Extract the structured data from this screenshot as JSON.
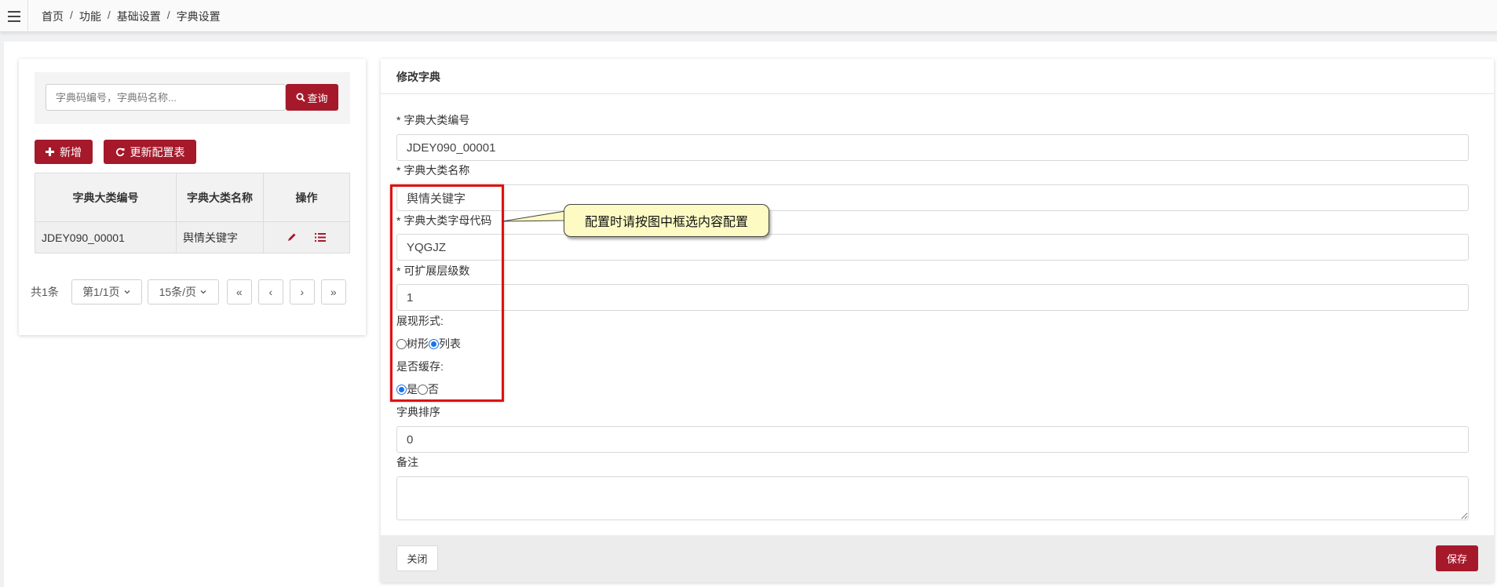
{
  "breadcrumb": {
    "items": [
      "首页",
      "功能",
      "基础设置",
      "字典设置"
    ],
    "separator": "/"
  },
  "search": {
    "placeholder": "字典码编号，字典码名称...",
    "button_label": "查询"
  },
  "toolbar": {
    "add_label": "新增",
    "refresh_label": "更新配置表"
  },
  "table": {
    "columns": [
      "字典大类编号",
      "字典大类名称",
      "操作"
    ],
    "rows": [
      {
        "code": "JDEY090_00001",
        "name": "舆情关键字"
      }
    ]
  },
  "pager": {
    "total": "共1条",
    "page": "第1/1页",
    "page_size": "15条/页",
    "first": "«",
    "prev": "‹",
    "next": "›",
    "last": "»"
  },
  "form": {
    "title": "修改字典",
    "fields": {
      "code_label": "* 字典大类编号",
      "code_value": "JDEY090_00001",
      "name_label": "* 字典大类名称",
      "name_value": "舆情关键字",
      "letter_label": "* 字典大类字母代码",
      "letter_value": "YQGJZ",
      "levels_label": "* 可扩展层级数",
      "levels_value": "1",
      "display_label": "展现形式:",
      "display_opt_tree": "树形",
      "display_opt_list": "列表",
      "display_selected": "列表",
      "cache_label": "是否缓存:",
      "cache_opt_yes": "是",
      "cache_opt_no": "否",
      "cache_selected": "是",
      "order_label": "字典排序",
      "order_value": "0",
      "remark_label": "备注",
      "remark_value": ""
    },
    "close_label": "关闭",
    "save_label": "保存"
  },
  "annotation": {
    "callout_text": "配置时请按图中框选内容配置"
  },
  "colors": {
    "accent": "#a5192b",
    "annotation_border": "#e01010",
    "callout_bg": "#fdfbc3",
    "radio_selected": "#1a73e8"
  }
}
